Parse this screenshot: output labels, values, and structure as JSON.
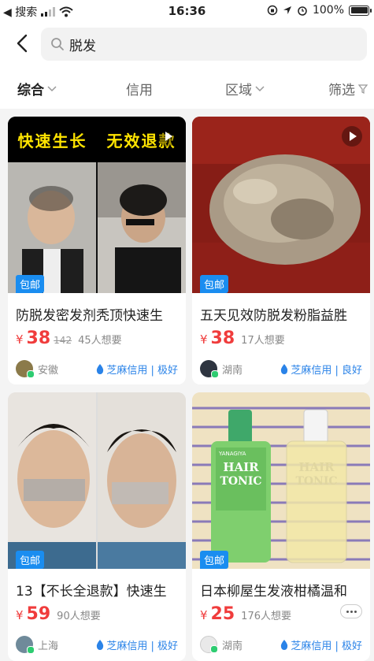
{
  "status": {
    "back_app": "◀ 搜索",
    "time": "16:36",
    "battery": "100%"
  },
  "search": {
    "value": "脱发",
    "placeholder": ""
  },
  "filters": [
    {
      "label": "综合"
    },
    {
      "label": "信用"
    },
    {
      "label": "区域"
    },
    {
      "label": "筛选"
    }
  ],
  "items": [
    {
      "banner_left": "快速生长",
      "banner_right": "无效退款",
      "badge": "包邮",
      "title": "防脱发密发剂秃顶快速生",
      "currency": "¥",
      "price": "38",
      "original_price": "142",
      "want": "45人想要",
      "location": "安徽",
      "credit": "芝麻信用 | 极好"
    },
    {
      "badge": "包邮",
      "title": "五天见效防脱发粉脂益胜",
      "currency": "¥",
      "price": "38",
      "want": "17人想要",
      "location": "湖南",
      "credit": "芝麻信用 | 良好"
    },
    {
      "badge": "包邮",
      "title": "13【不长全退款】快速生",
      "currency": "¥",
      "price": "59",
      "want": "90人想要",
      "location": "上海",
      "credit": "芝麻信用 | 极好"
    },
    {
      "bottle_text_1": "HAIR",
      "bottle_text_2": "TONIC",
      "bottle_brand": "YANAGIYA",
      "badge": "包邮",
      "title": "日本柳屋生发液柑橘温和",
      "currency": "¥",
      "price": "25",
      "want": "176人想要",
      "location": "湖南",
      "credit": "芝麻信用 | 极好"
    }
  ],
  "colors": {
    "price": "#f03c3c",
    "badge": "#1a8df0",
    "credit": "#2a83e8"
  }
}
